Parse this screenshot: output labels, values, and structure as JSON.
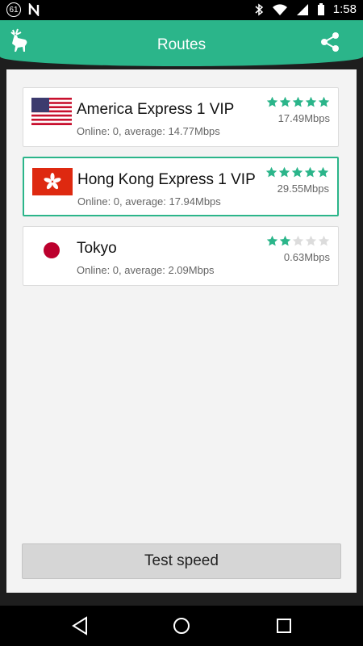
{
  "status_bar": {
    "notification_count": "61",
    "time": "1:58",
    "icons": [
      "n-icon",
      "bluetooth-icon",
      "wifi-icon",
      "signal-icon",
      "battery-icon"
    ]
  },
  "app_bar": {
    "title": "Routes",
    "left_icon": "deer-logo-icon",
    "right_icon": "share-icon"
  },
  "routes": [
    {
      "name": "America Express 1 VIP",
      "status": "Online: 0, average: 14.77Mbps",
      "speed": "17.49Mbps",
      "rating": 5,
      "flag": "usa-flag-icon",
      "selected": false
    },
    {
      "name": "Hong Kong Express 1 VIP",
      "status": "Online: 0, average: 17.94Mbps",
      "speed": "29.55Mbps",
      "rating": 5,
      "flag": "hong-kong-flag-icon",
      "selected": true
    },
    {
      "name": "Tokyo",
      "status": "Online: 0, average: 2.09Mbps",
      "speed": "0.63Mbps",
      "rating": 2,
      "flag": "japan-flag-icon",
      "selected": false
    }
  ],
  "test_button": {
    "label": "Test speed"
  },
  "colors": {
    "accent": "#2bb58a",
    "star_empty": "#dcdcdc",
    "background": "#f3f3f3"
  }
}
